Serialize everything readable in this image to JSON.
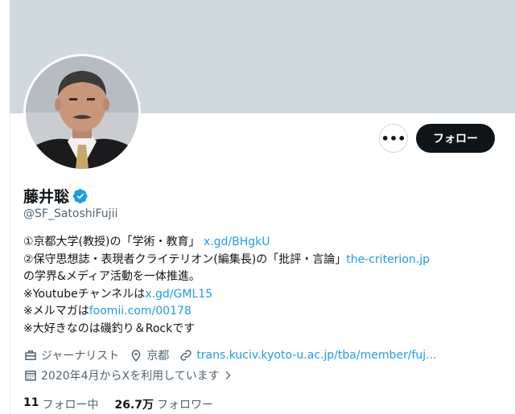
{
  "profile": {
    "name": "藤井聡",
    "handle": "@SF_SatoshiFujii",
    "more_label": "•••",
    "follow_label": "フォロー",
    "bio": {
      "line1_text": "①京都大学(教授)の「学術・教育」 ",
      "line1_link": "x.gd/BHgkU",
      "line2_text": "②保守思想誌・表現者クライテリオン(編集長)の「批評・言論」",
      "line2_link": "the-criterion.jp",
      "line3_text": "の学界&メディア活動を一体推進。",
      "line4_text": "※Youtubeチャンネルは",
      "line4_link": "x.gd/GML15",
      "line5_text": "※メルマガは",
      "line5_link": "foomii.com/00178",
      "line6_text": "※大好きなのは磯釣り＆Rockです"
    },
    "meta": {
      "occupation": "ジャーナリスト",
      "location": "京都",
      "url": "trans.kuciv.kyoto-u.ac.jp/tba/member/fuj...",
      "joined": "2020年4月からXを利用しています"
    },
    "stats": {
      "following_count": "11",
      "following_label": "フォロー中",
      "followers_count": "26.7万",
      "followers_label": "フォロワー"
    }
  },
  "colors": {
    "banner": "#cfd9de",
    "link": "#1d9bf0",
    "verified": "#1d9bf0",
    "button_bg": "#0f1419",
    "secondary_text": "#536471"
  },
  "icons": {
    "occupation": "briefcase-icon",
    "location": "location-pin-icon",
    "url": "link-icon",
    "joined": "calendar-icon",
    "verified": "verified-badge-icon",
    "joined_chevron": "chevron-right-icon"
  }
}
